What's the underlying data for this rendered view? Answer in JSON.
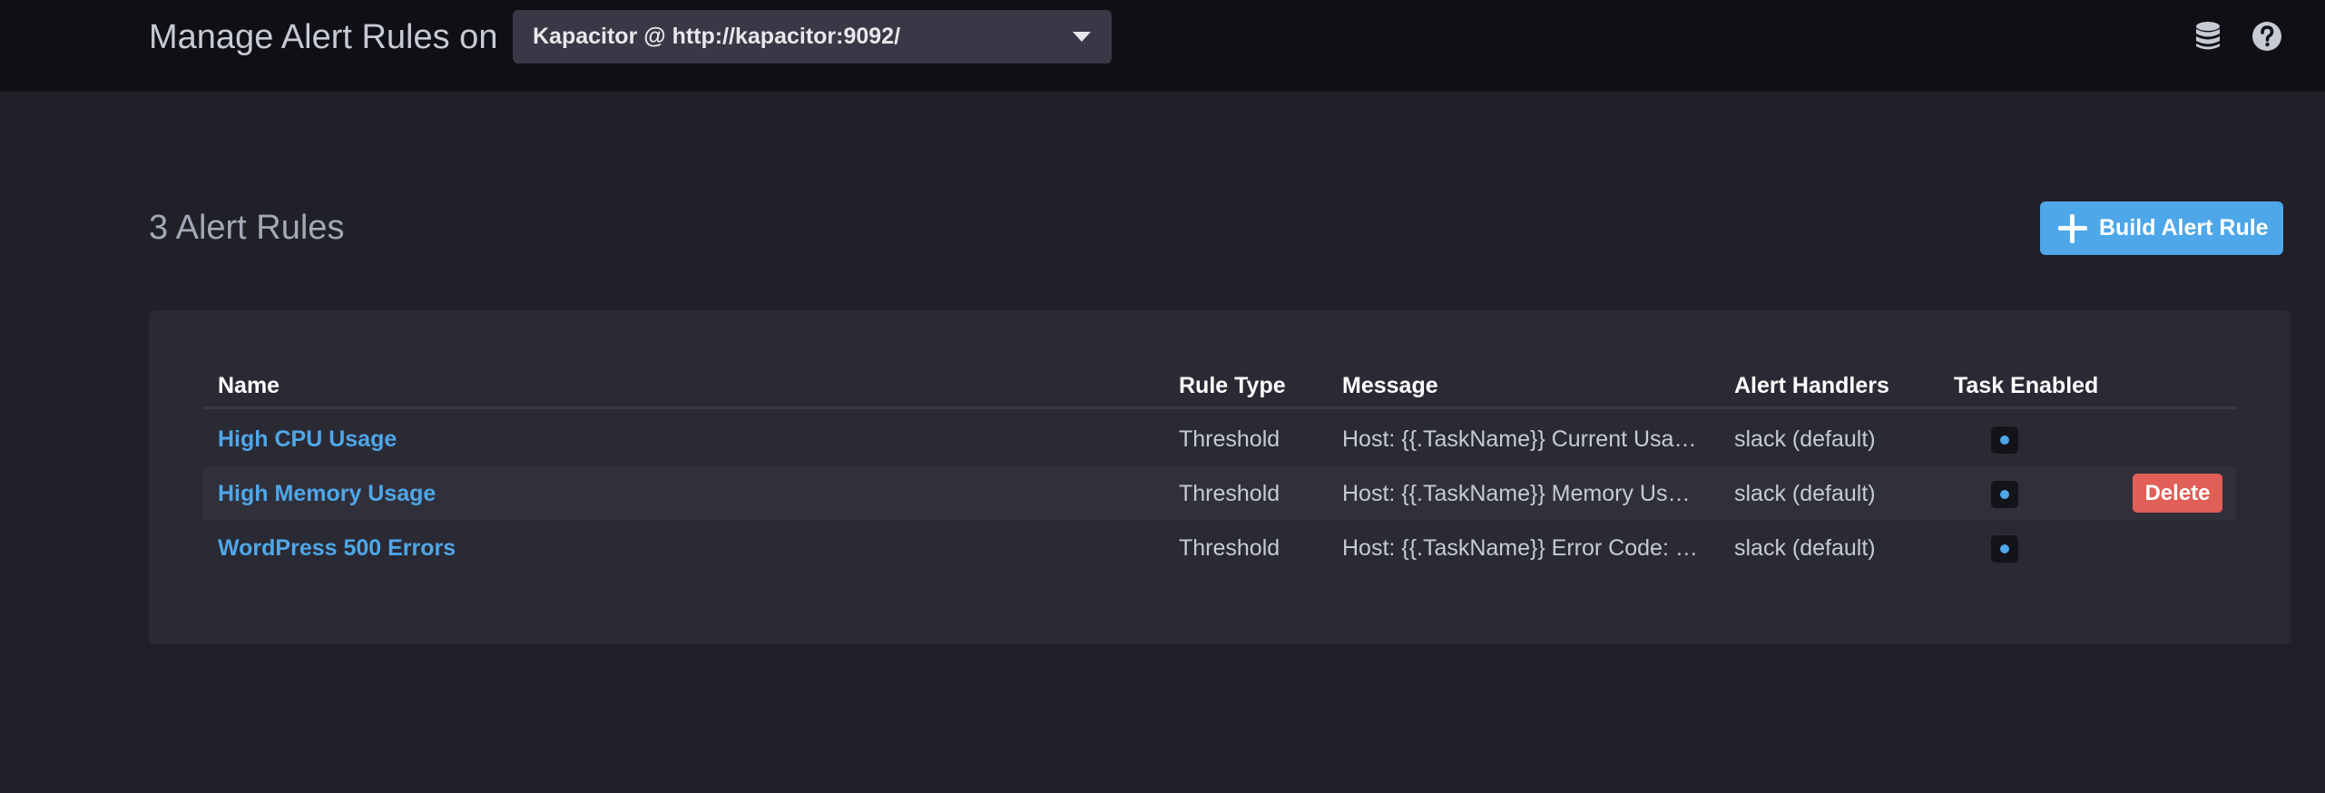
{
  "header": {
    "title": "Manage Alert Rules on",
    "source_dropdown": {
      "selected": "Kapacitor @ http://kapacitor:9092/",
      "caret_icon": "chevron-down-icon"
    },
    "icons": [
      "database-icon",
      "help-icon"
    ]
  },
  "main": {
    "count_heading": "3 Alert Rules",
    "build_button_label": "Build Alert Rule",
    "build_button_icon": "plus-icon"
  },
  "table": {
    "columns": [
      "Name",
      "Rule Type",
      "Message",
      "Alert Handlers",
      "Task Enabled"
    ],
    "rows": [
      {
        "name": "High CPU Usage",
        "rule_type": "Threshold",
        "message": "Host: {{.TaskName}} Current Usa…",
        "handlers": "slack (default)",
        "enabled": true
      },
      {
        "name": "High Memory Usage",
        "rule_type": "Threshold",
        "message": "Host: {{.TaskName}} Memory Us…",
        "handlers": "slack (default)",
        "enabled": true,
        "delete_label": "Delete"
      },
      {
        "name": "WordPress 500 Errors",
        "rule_type": "Threshold",
        "message": "Host: {{.TaskName}} Error Code: …",
        "handlers": "slack (default)",
        "enabled": true
      }
    ]
  },
  "colors": {
    "accent": "#4ea7e8",
    "danger": "#e05f57",
    "topbar_bg": "#0f0f15",
    "page_bg": "#202028",
    "panel_bg": "#2a2a34"
  }
}
